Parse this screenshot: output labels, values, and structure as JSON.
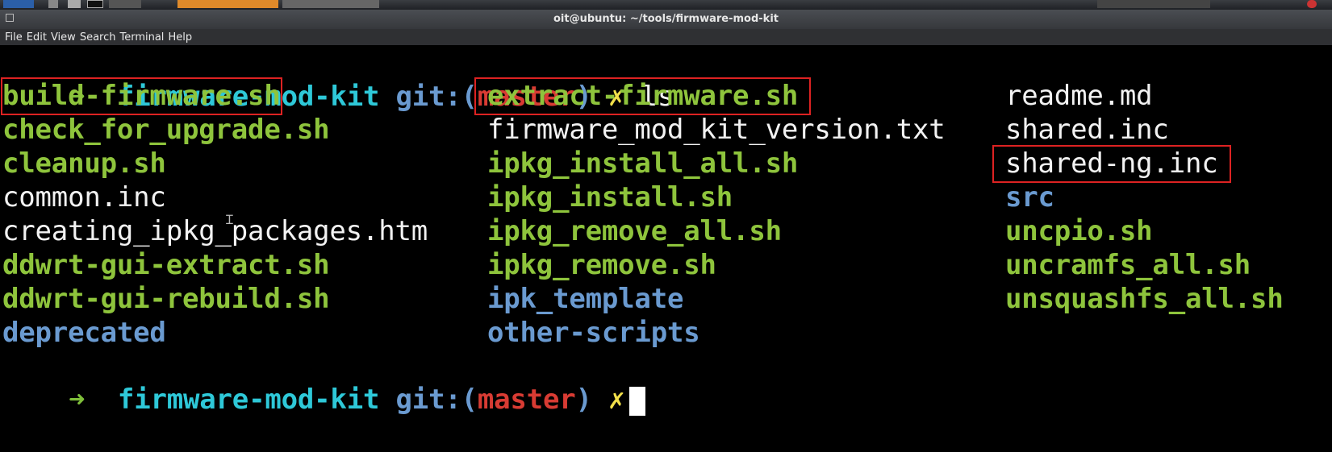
{
  "window": {
    "title": "oit@ubuntu: ~/tools/firmware-mod-kit"
  },
  "menu": {
    "items": [
      "File",
      "Edit",
      "View",
      "Search",
      "Terminal",
      "Help"
    ]
  },
  "prompt": {
    "arrow": "➜",
    "dir": "firmware-mod-kit",
    "git_prefix": "git:(",
    "branch": "master",
    "git_suffix": ")",
    "dirty_mark": "✗",
    "command": "ls"
  },
  "listing": {
    "col1": [
      {
        "name": "build-firmware.sh",
        "kind": "exe",
        "highlight": true
      },
      {
        "name": "check_for_upgrade.sh",
        "kind": "exe"
      },
      {
        "name": "cleanup.sh",
        "kind": "exe"
      },
      {
        "name": "common.inc",
        "kind": "file"
      },
      {
        "name": "creating_ipkg_packages.htm",
        "kind": "file"
      },
      {
        "name": "ddwrt-gui-extract.sh",
        "kind": "exe"
      },
      {
        "name": "ddwrt-gui-rebuild.sh",
        "kind": "exe"
      },
      {
        "name": "deprecated",
        "kind": "folder"
      }
    ],
    "col2": [
      {
        "name": "extract-firmware.sh",
        "kind": "exe",
        "highlight": true
      },
      {
        "name": "firmware_mod_kit_version.txt",
        "kind": "file"
      },
      {
        "name": "ipkg_install_all.sh",
        "kind": "exe"
      },
      {
        "name": "ipkg_install.sh",
        "kind": "exe"
      },
      {
        "name": "ipkg_remove_all.sh",
        "kind": "exe"
      },
      {
        "name": "ipkg_remove.sh",
        "kind": "exe"
      },
      {
        "name": "ipk_template",
        "kind": "folder"
      },
      {
        "name": "other-scripts",
        "kind": "folder"
      }
    ],
    "col3": [
      {
        "name": "readme.md",
        "kind": "file"
      },
      {
        "name": "shared.inc",
        "kind": "file"
      },
      {
        "name": "shared-ng.inc",
        "kind": "file",
        "highlight": true
      },
      {
        "name": "src",
        "kind": "folder"
      },
      {
        "name": "uncpio.sh",
        "kind": "exe"
      },
      {
        "name": "uncramfs_all.sh",
        "kind": "exe"
      },
      {
        "name": "unsquashfs_all.sh",
        "kind": "exe"
      }
    ]
  },
  "colors": {
    "executable": "#8ec43c",
    "directory": "#6a9ad0",
    "plain_file": "#f2f2f2",
    "prompt_dir": "#2ec8d8",
    "branch": "#d83b33",
    "dirty": "#f2e04a",
    "annotation_box": "#dd2222"
  }
}
